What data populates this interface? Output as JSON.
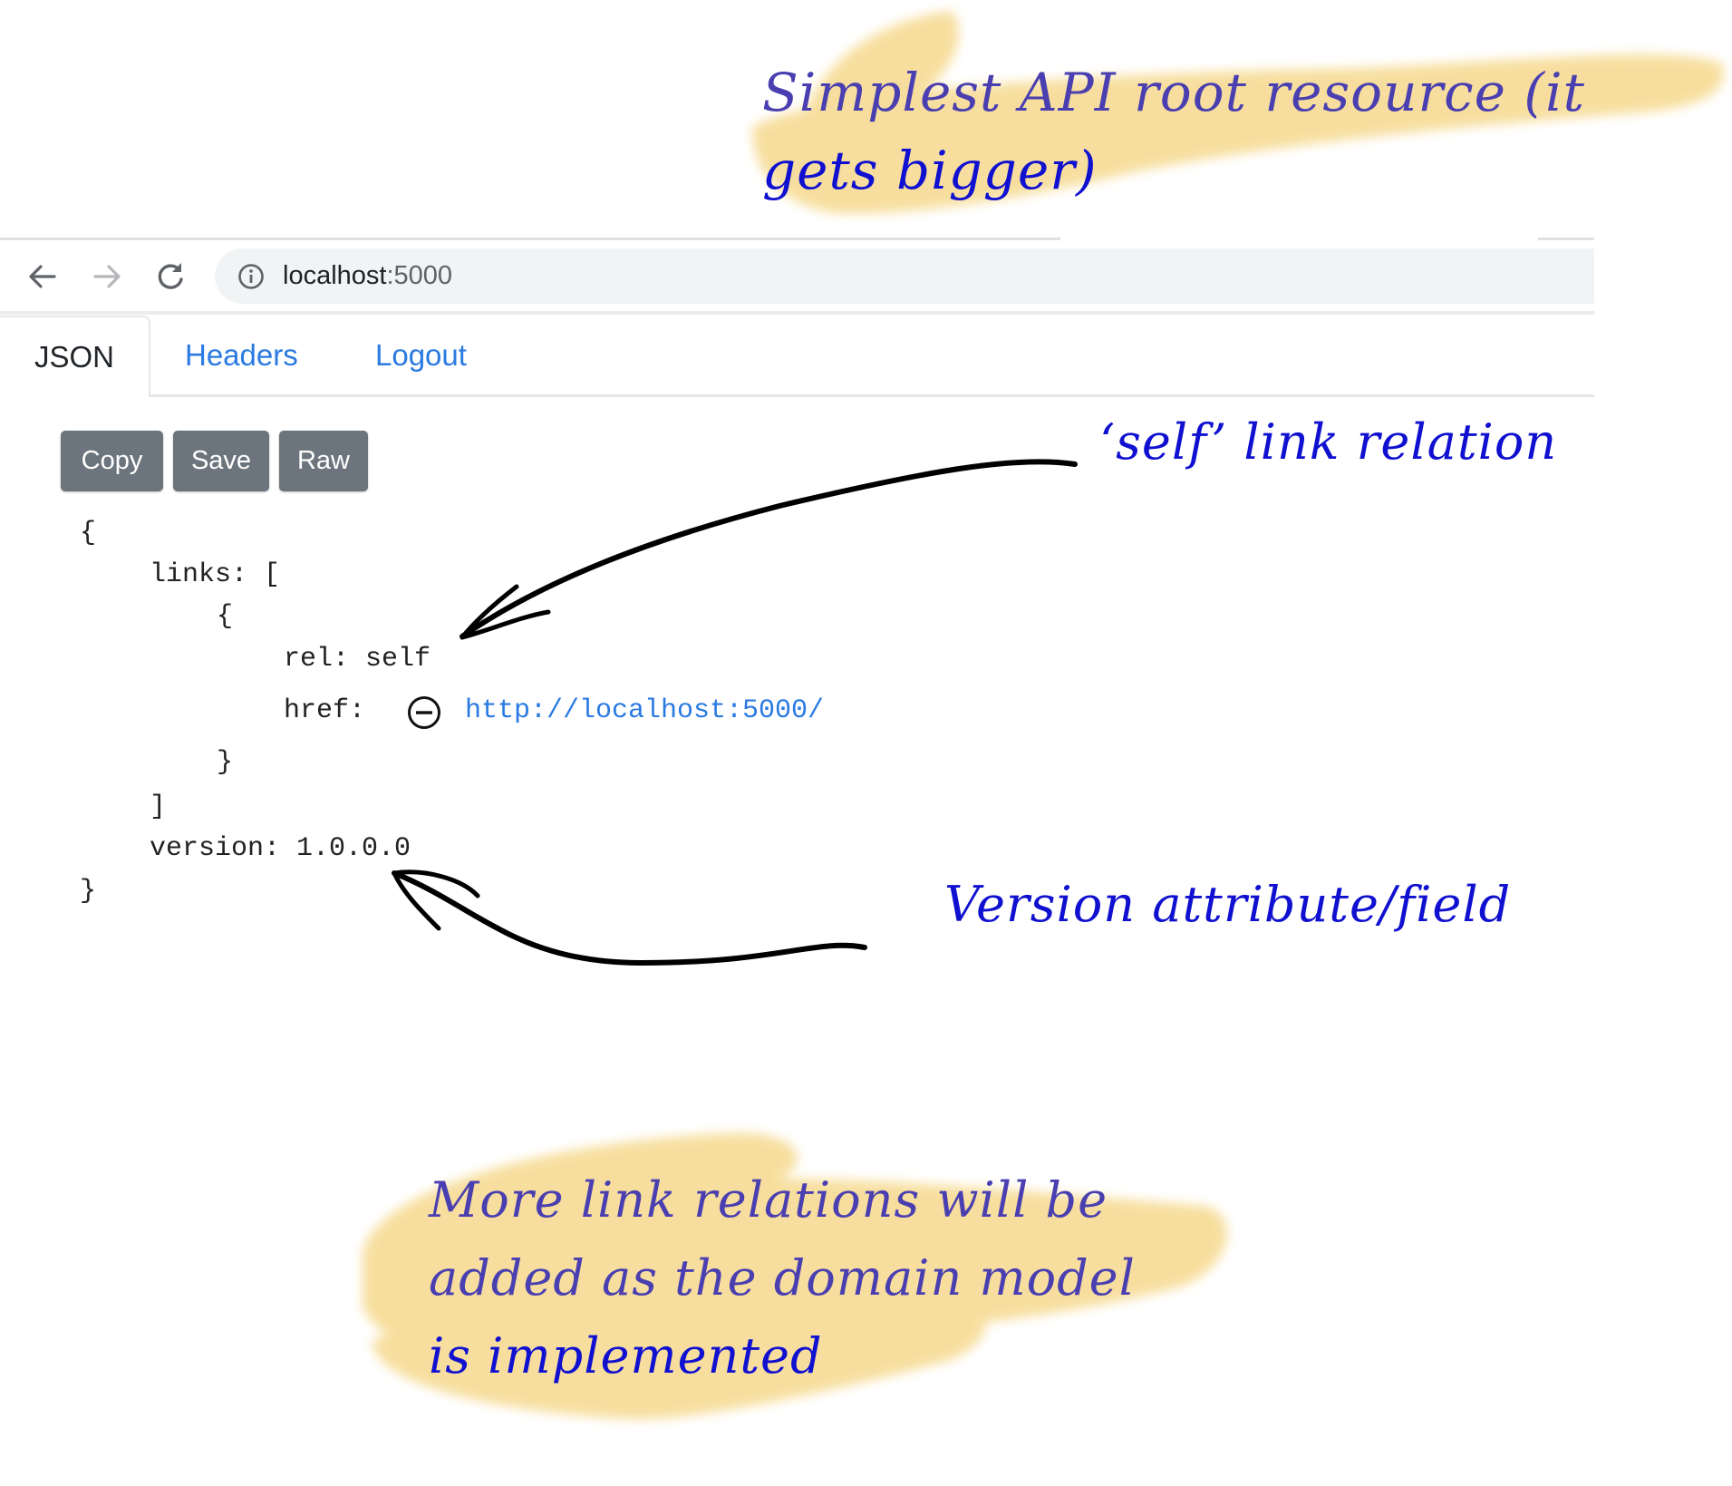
{
  "browser": {
    "url_host": "localhost",
    "url_port": ":5000",
    "icons": {
      "back": "arrow-left-icon",
      "forward": "arrow-right-icon",
      "reload": "reload-icon",
      "site_info": "info-icon"
    }
  },
  "tabs": [
    {
      "label": "JSON",
      "active": true
    },
    {
      "label": "Headers",
      "active": false
    },
    {
      "label": "Logout",
      "active": false
    }
  ],
  "toolbar": {
    "copy_label": "Copy",
    "save_label": "Save",
    "raw_label": "Raw",
    "button_color": "#6c757d"
  },
  "json_view": {
    "open_brace": "{",
    "links_key": "links: [",
    "link_open": "{",
    "rel_line": "rel: self",
    "href_key": "href:",
    "href_value": "http://localhost:5000/",
    "href_icon": "minus-circle-icon",
    "link_close": "}",
    "links_close": "]",
    "version_line": "version: 1.0.0.0",
    "close_brace": "}",
    "link_color": "#2a7ae2"
  },
  "annotations": {
    "top_note_line1": "Simplest API root resource (it",
    "top_note_line2": "gets bigger)",
    "self_note": "‘self’ link relation",
    "version_note": "Version attribute/field",
    "bottom_note_line1": "More link relations will be",
    "bottom_note_line2": "added as the domain model",
    "bottom_note_line3": "is implemented",
    "ink_color": "#1010d0",
    "highlight_color": "#f6d98e"
  }
}
